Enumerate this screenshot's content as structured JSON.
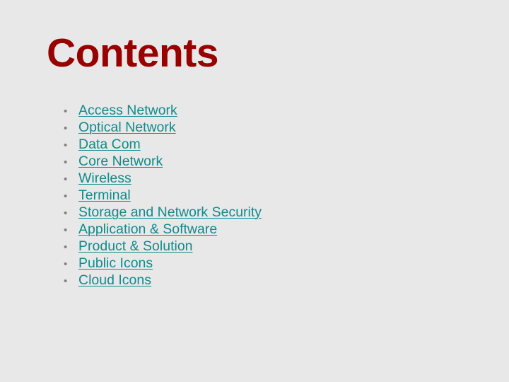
{
  "slide": {
    "title": "Contents",
    "background_color": "#e8e8e8",
    "title_color": "#990000",
    "link_color": "#108b8b",
    "bullet_color": "#808080",
    "bullet_glyph": "•",
    "items": [
      {
        "label": "Access Network"
      },
      {
        "label": "Optical Network"
      },
      {
        "label": "Data Com"
      },
      {
        "label": "Core Network"
      },
      {
        "label": "Wireless"
      },
      {
        "label": "Terminal"
      },
      {
        "label": "Storage and Network Security"
      },
      {
        "label": "Application & Software"
      },
      {
        "label": "Product & Solution"
      },
      {
        "label": "Public Icons"
      },
      {
        "label": "Cloud Icons"
      }
    ]
  }
}
